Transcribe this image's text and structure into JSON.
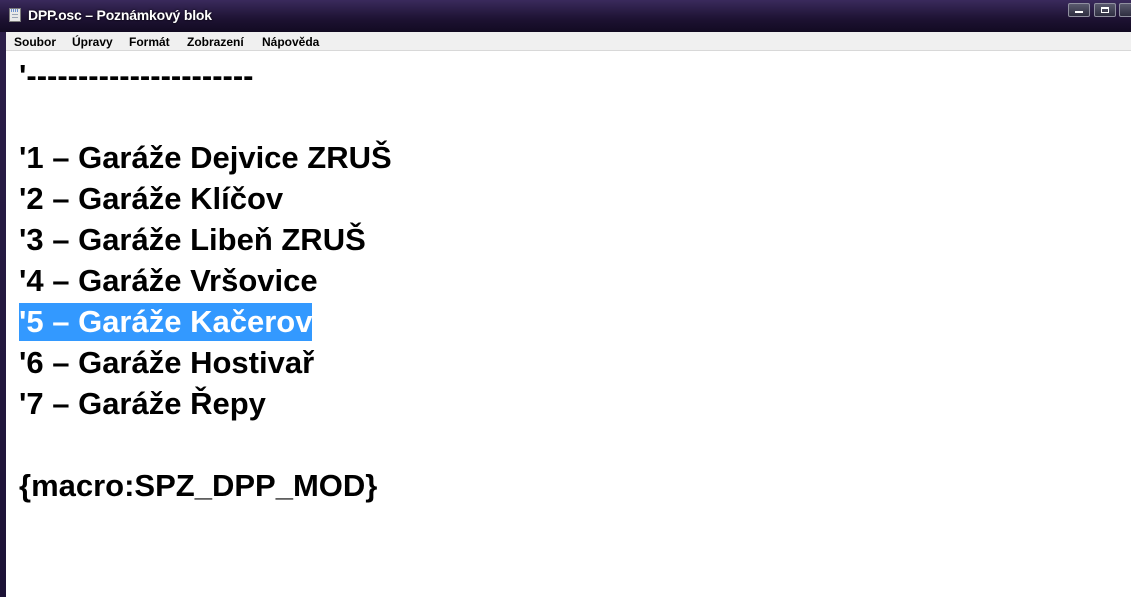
{
  "window": {
    "title": "DPP.osc – Poznámkový blok"
  },
  "menu": {
    "items": [
      "Soubor",
      "Úpravy",
      "Formát",
      "Zobrazení",
      "Nápověda"
    ]
  },
  "editor": {
    "lines": [
      "'----------------------",
      "",
      "'1 – Garáže Dejvice ZRUŠ",
      "'2 – Garáže Klíčov",
      "'3 – Garáže Libeň ZRUŠ",
      "'4 – Garáže Vršovice",
      "'5 – Garáže Kačerov",
      "'6 – Garáže Hostivař",
      "'7 – Garáže Řepy",
      "",
      "{macro:SPZ_DPP_MOD}"
    ],
    "selected_line_index": 6
  },
  "icons": {
    "app": "notepad-icon",
    "minimize": "minimize-icon",
    "maximize": "maximize-icon",
    "close": "close-icon"
  },
  "colors": {
    "selection": "#3399ff",
    "titlebar": "#1d1232"
  }
}
